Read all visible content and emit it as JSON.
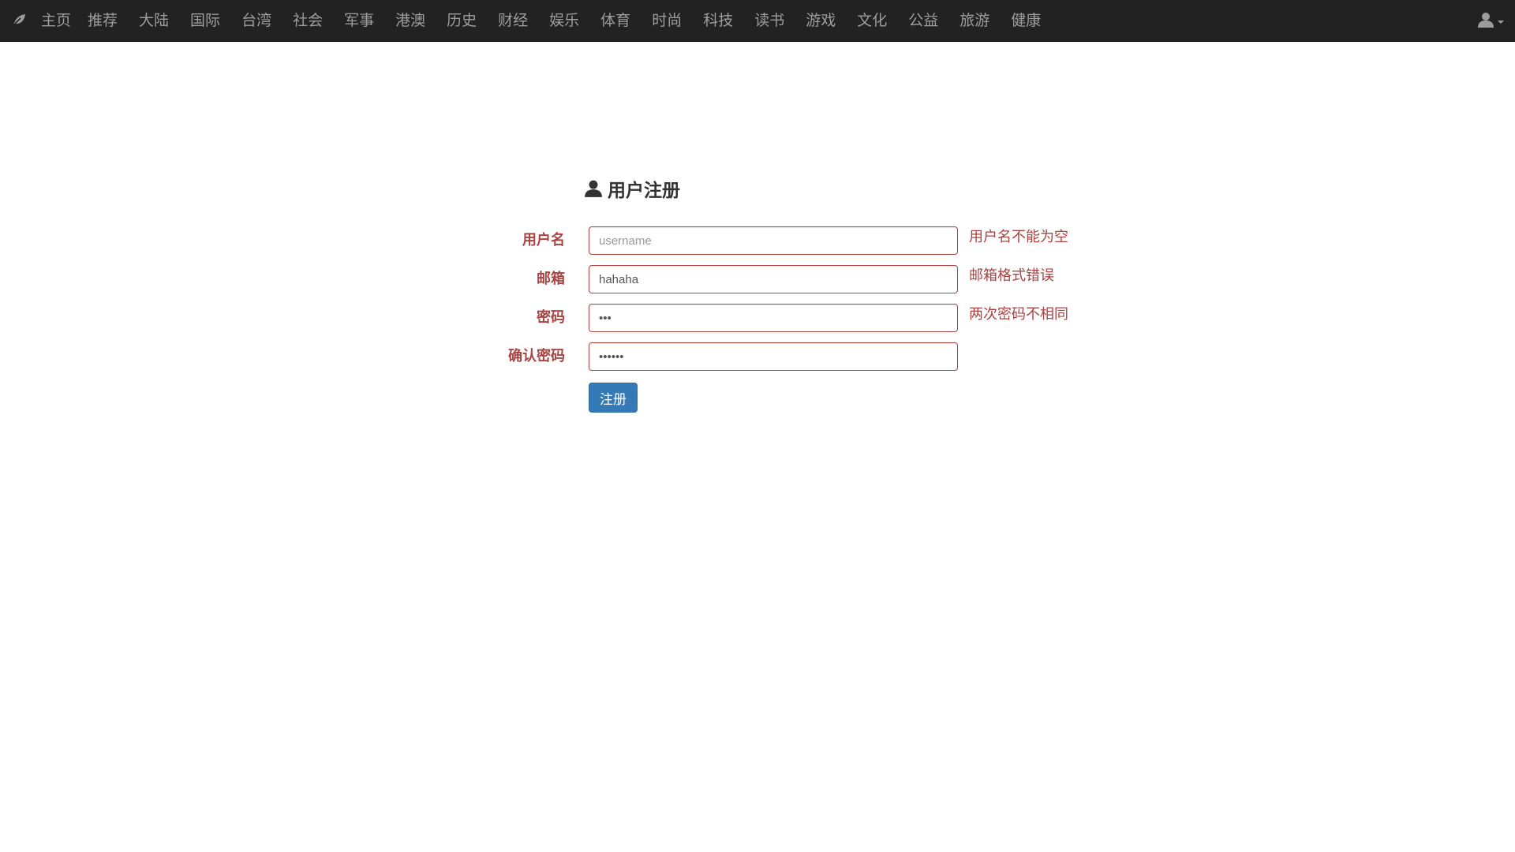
{
  "navbar": {
    "brand_icon": "leaf-icon",
    "items": [
      {
        "label": "主页"
      },
      {
        "label": "推荐"
      },
      {
        "label": "大陆"
      },
      {
        "label": "国际"
      },
      {
        "label": "台湾"
      },
      {
        "label": "社会"
      },
      {
        "label": "军事"
      },
      {
        "label": "港澳"
      },
      {
        "label": "历史"
      },
      {
        "label": "财经"
      },
      {
        "label": "娱乐"
      },
      {
        "label": "体育"
      },
      {
        "label": "时尚"
      },
      {
        "label": "科技"
      },
      {
        "label": "读书"
      },
      {
        "label": "游戏"
      },
      {
        "label": "文化"
      },
      {
        "label": "公益"
      },
      {
        "label": "旅游"
      },
      {
        "label": "健康"
      }
    ],
    "user_icon": "user-icon"
  },
  "form": {
    "title": "用户注册",
    "title_icon": "user-icon",
    "fields": {
      "username": {
        "label": "用户名",
        "value": "",
        "placeholder": "username",
        "error": "用户名不能为空"
      },
      "email": {
        "label": "邮箱",
        "value": "hahaha",
        "placeholder": "",
        "error": "邮箱格式错误"
      },
      "password": {
        "label": "密码",
        "value": "abc",
        "placeholder": "",
        "error": "两次密码不相同"
      },
      "confirm_password": {
        "label": "确认密码",
        "value": "abcdef",
        "placeholder": "",
        "error": ""
      }
    },
    "submit_label": "注册"
  },
  "colors": {
    "navbar_bg": "#222222",
    "nav_text": "#9d9d9d",
    "error": "#a94442",
    "primary": "#337ab7"
  }
}
